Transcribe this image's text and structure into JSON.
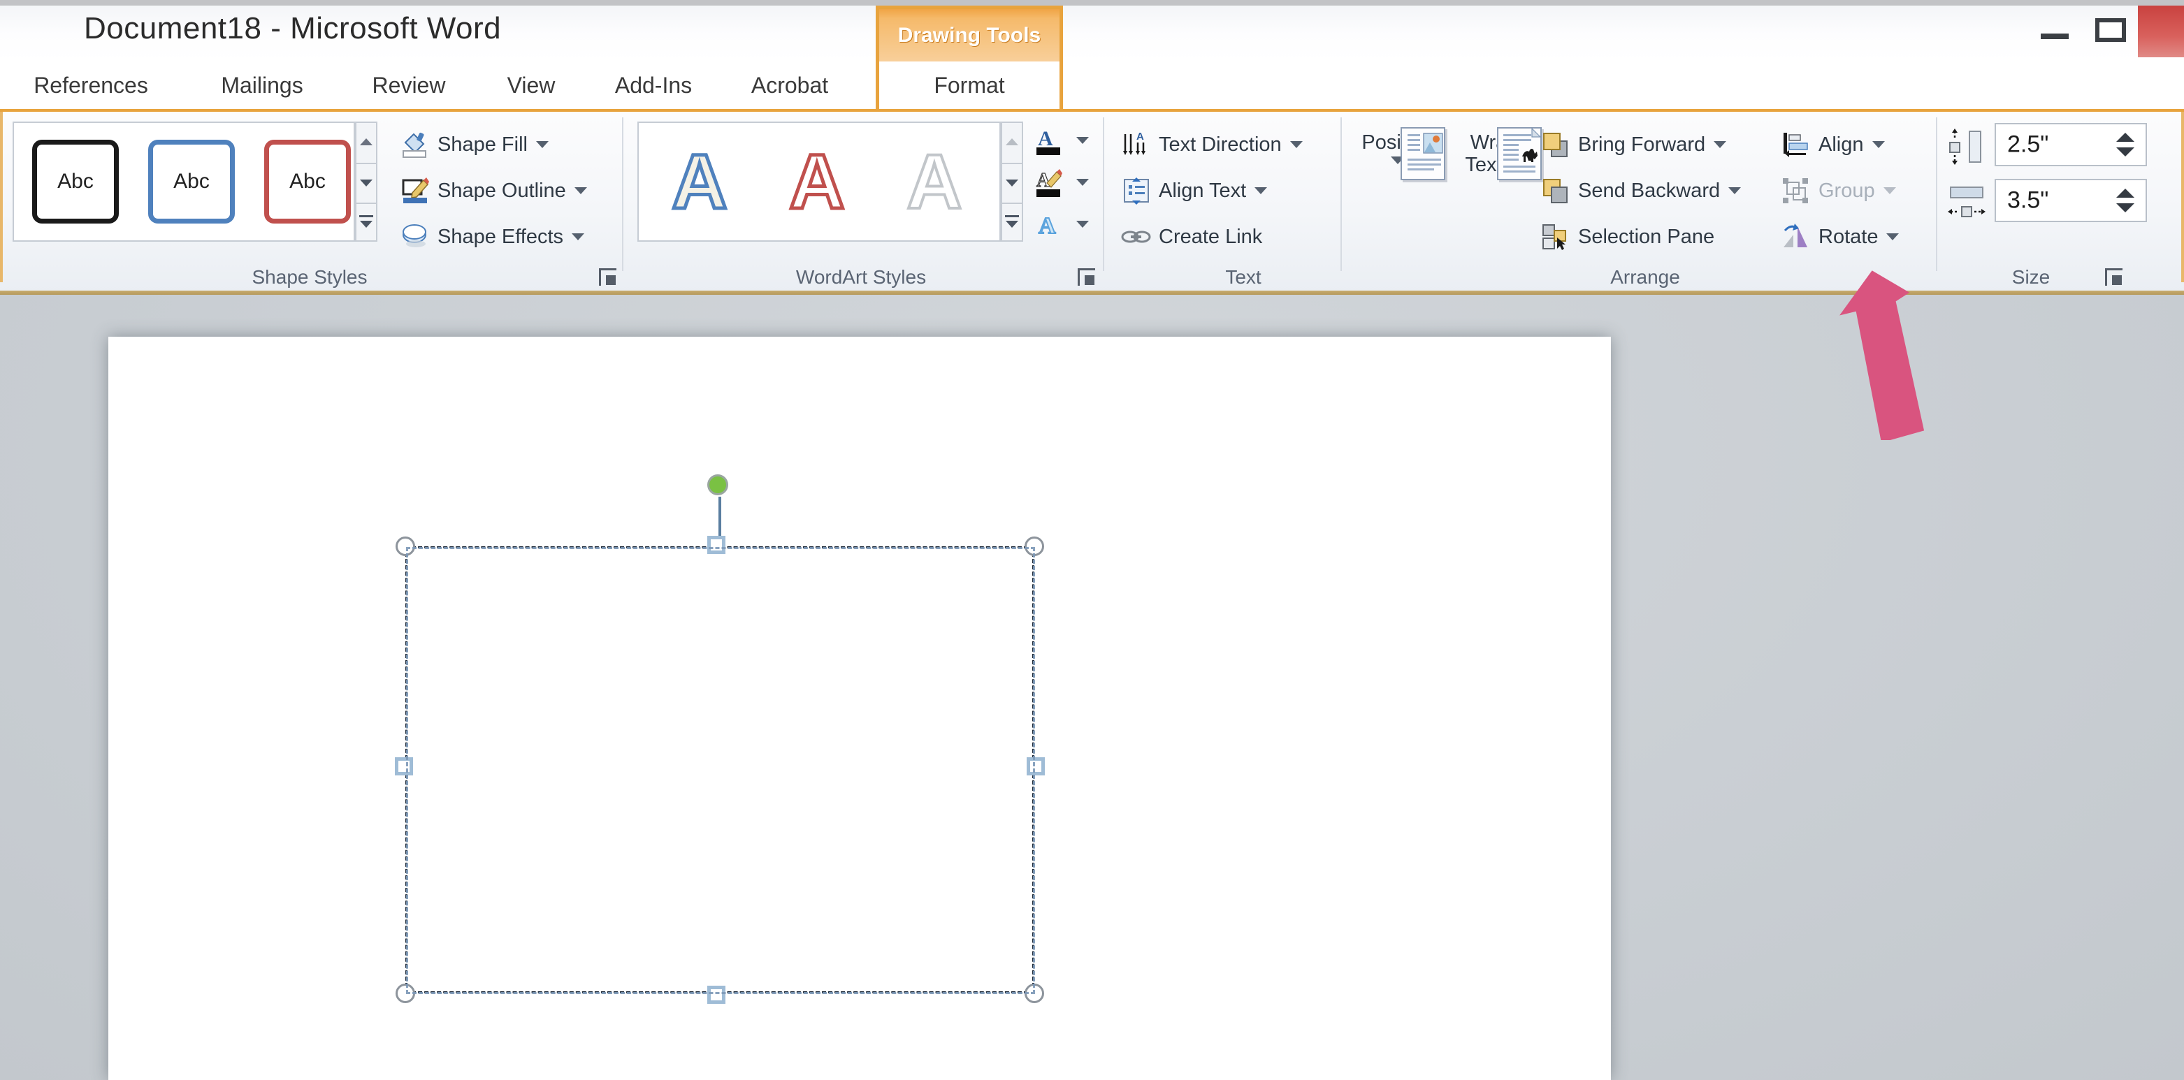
{
  "window": {
    "title": "Document18 - Microsoft Word",
    "buttons": {
      "minimize": "minimize",
      "maximize": "maximize",
      "close": "close"
    }
  },
  "ribbon": {
    "tabs": [
      {
        "label": "References"
      },
      {
        "label": "Mailings"
      },
      {
        "label": "Review"
      },
      {
        "label": "View"
      },
      {
        "label": "Add-Ins"
      },
      {
        "label": "Acrobat"
      }
    ],
    "contextual": {
      "header": "Drawing Tools",
      "tab": "Format"
    },
    "groups": {
      "shape_styles": {
        "label": "Shape Styles",
        "thumbnails": [
          {
            "text": "Abc",
            "outline_color": "#1a1a1a"
          },
          {
            "text": "Abc",
            "outline_color": "#4f81bd"
          },
          {
            "text": "Abc",
            "outline_color": "#c0504d"
          }
        ],
        "commands": [
          {
            "label": "Shape Fill",
            "icon": "paint-bucket-icon",
            "has_caret": true
          },
          {
            "label": "Shape Outline",
            "icon": "pencil-outline-icon",
            "has_caret": true
          },
          {
            "label": "Shape Effects",
            "icon": "shape-effects-icon",
            "has_caret": true
          }
        ],
        "dialog_launcher": "shape-styles-dialog-launcher"
      },
      "wordart_styles": {
        "label": "WordArt Styles",
        "thumbnails": [
          {
            "text": "A",
            "color": "#4f81bd"
          },
          {
            "text": "A",
            "color": "#c0504d"
          },
          {
            "text": "A",
            "color": "#b9bdc2"
          }
        ],
        "commands": [
          {
            "label": "Text Fill",
            "icon": "text-fill-icon",
            "has_caret": true
          },
          {
            "label": "Text Outline",
            "icon": "text-outline-icon",
            "has_caret": true
          },
          {
            "label": "Text Effects",
            "icon": "text-effects-icon",
            "has_caret": true
          }
        ],
        "dialog_launcher": "wordart-styles-dialog-launcher"
      },
      "text": {
        "label": "Text",
        "commands": [
          {
            "label": "Text Direction",
            "icon": "text-direction-icon",
            "has_caret": true
          },
          {
            "label": "Align Text",
            "icon": "align-text-icon",
            "has_caret": true
          },
          {
            "label": "Create Link",
            "icon": "create-link-icon",
            "has_caret": false
          }
        ]
      },
      "arrange": {
        "label": "Arrange",
        "big_commands": [
          {
            "label": "Position",
            "icon": "position-icon",
            "has_caret": true
          },
          {
            "label": "Wrap Text",
            "label_line1": "Wrap",
            "label_line2": "Text",
            "icon": "wrap-text-icon",
            "has_caret": true
          }
        ],
        "commands": [
          {
            "label": "Bring Forward",
            "icon": "bring-forward-icon",
            "has_caret": true,
            "disabled": false
          },
          {
            "label": "Send Backward",
            "icon": "send-backward-icon",
            "has_caret": true,
            "disabled": false
          },
          {
            "label": "Selection Pane",
            "icon": "selection-pane-icon",
            "has_caret": false,
            "disabled": false
          },
          {
            "label": "Align",
            "icon": "align-objects-icon",
            "has_caret": true,
            "disabled": false
          },
          {
            "label": "Group",
            "icon": "group-icon",
            "has_caret": true,
            "disabled": true
          },
          {
            "label": "Rotate",
            "icon": "rotate-icon",
            "has_caret": true,
            "disabled": false
          }
        ]
      },
      "size": {
        "label": "Size",
        "height": {
          "icon": "shape-height-icon",
          "value": "2.5\""
        },
        "width": {
          "icon": "shape-width-icon",
          "value": "3.5\""
        },
        "dialog_launcher": "size-dialog-launcher"
      }
    }
  },
  "document": {
    "selection": {
      "name": "selected-text-box",
      "handles": 8,
      "rotation_handle": "rotation-handle"
    }
  },
  "annotation": {
    "arrow": {
      "name": "callout-arrow",
      "color": "#d9547f",
      "points_to": "Size group"
    }
  },
  "colors": {
    "contextual_orange": "#e8a33d",
    "ribbon_rule": "#b59a5d",
    "close_red": "#c9423f",
    "rotation_green": "#7ac143",
    "annotation_pink": "#d9547f"
  }
}
